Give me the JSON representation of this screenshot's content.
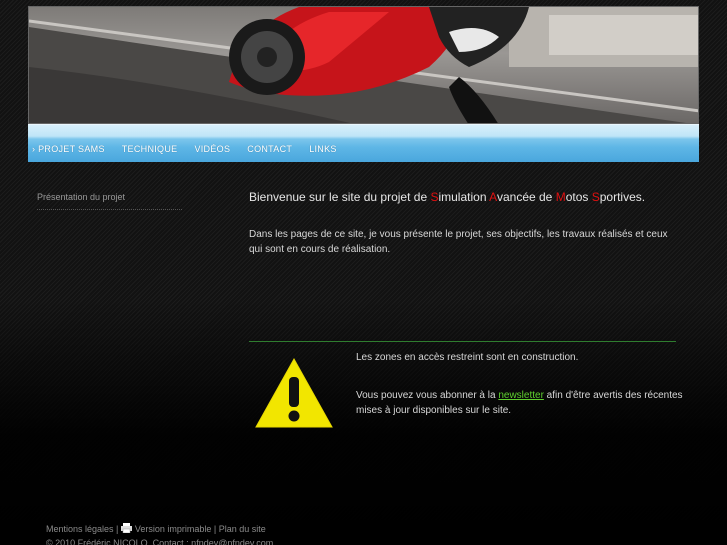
{
  "nav": {
    "items": [
      {
        "label": "› PROJET SAMS"
      },
      {
        "label": "TECHNIQUE"
      },
      {
        "label": "VIDÉOS"
      },
      {
        "label": "CONTACT"
      },
      {
        "label": "LINKS"
      }
    ]
  },
  "sidebar": {
    "items": [
      {
        "label": "Présentation du projet"
      }
    ]
  },
  "main": {
    "welcome": {
      "p1": "Bienvenue sur le site du projet de ",
      "s": "S",
      "p2": "imulation ",
      "a": "A",
      "p3": "vancée de ",
      "m": "M",
      "p4": "otos ",
      "s2": "S",
      "p5": "portives."
    },
    "intro": "Dans les pages de ce site, je vous présente le projet, ses objectifs, les travaux réalisés et ceux qui sont en cours de réalisation.",
    "notice": {
      "line1": "Les zones en accès restreint sont en construction.",
      "subscribe_prefix": "Vous pouvez vous abonner à la ",
      "newsletter_link": "newsletter",
      "subscribe_suffix": " afin d'être avertis des récentes mises à jour disponibles sur le site."
    }
  },
  "footer": {
    "legal": "Mentions légales",
    "sep1": " | ",
    "print": "Version imprimable",
    "sep2": " | ",
    "sitemap": "Plan du site",
    "copyright": "© 2010 Frédéric NICOLO. Contact : nfndev@nfndev.com"
  },
  "colors": {
    "accent_red": "#e01010",
    "link_green": "#5fd02f",
    "nav_blue": "#5eb6e6",
    "divider_green": "#2f7d2f"
  },
  "icons": [
    "warning-icon",
    "printer-icon"
  ]
}
